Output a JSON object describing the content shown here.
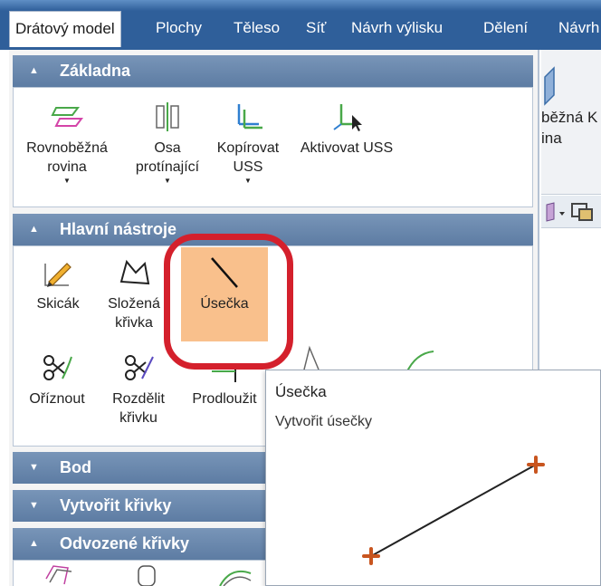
{
  "tabs": {
    "wireframe": "Drátový model",
    "surfaces": "Plochy",
    "solid": "Těleso",
    "mesh": "Síť",
    "mold_design": "Návrh výlisku",
    "split": "Dělení",
    "overflow": "Návrh"
  },
  "sections": {
    "basic": {
      "title": "Základna",
      "tools": {
        "parallel_plane": {
          "line1": "Rovnoběžná",
          "line2": "rovina",
          "drop": "▼"
        },
        "intersecting_axis": {
          "line1": "Osa",
          "line2": "protínající",
          "drop": "▼"
        },
        "copy_ucs": {
          "line1": "Kopírovat",
          "line2": "USS",
          "drop": "▼"
        },
        "activate_ucs": {
          "line1": "Aktivovat USS"
        }
      }
    },
    "main_tools": {
      "title": "Hlavní nástroje",
      "tools": {
        "sketch": {
          "line1": "Skicák"
        },
        "composite_curve": {
          "line1": "Složená",
          "line2": "křivka"
        },
        "line": {
          "line1": "Úsečka"
        },
        "trim": {
          "line1": "Oříznout"
        },
        "split_curve": {
          "line1": "Rozdělit",
          "line2": "křivku"
        },
        "extend": {
          "line1": "Prodloužit"
        }
      }
    },
    "point": {
      "title": "Bod"
    },
    "create_curves": {
      "title": "Vytvořit křivky"
    },
    "derived_curves": {
      "title": "Odvozené křivky"
    }
  },
  "right_panel": {
    "text1": "běžná K",
    "text2": "ina"
  },
  "tooltip": {
    "title": "Úsečka",
    "description": "Vytvořit úsečky"
  },
  "colors": {
    "tab_bar": "#2f5f9a",
    "section_header": "#6887ad",
    "highlight": "#f9c08c",
    "callout_ring": "#d4202c",
    "point_marker": "#c8551f"
  }
}
